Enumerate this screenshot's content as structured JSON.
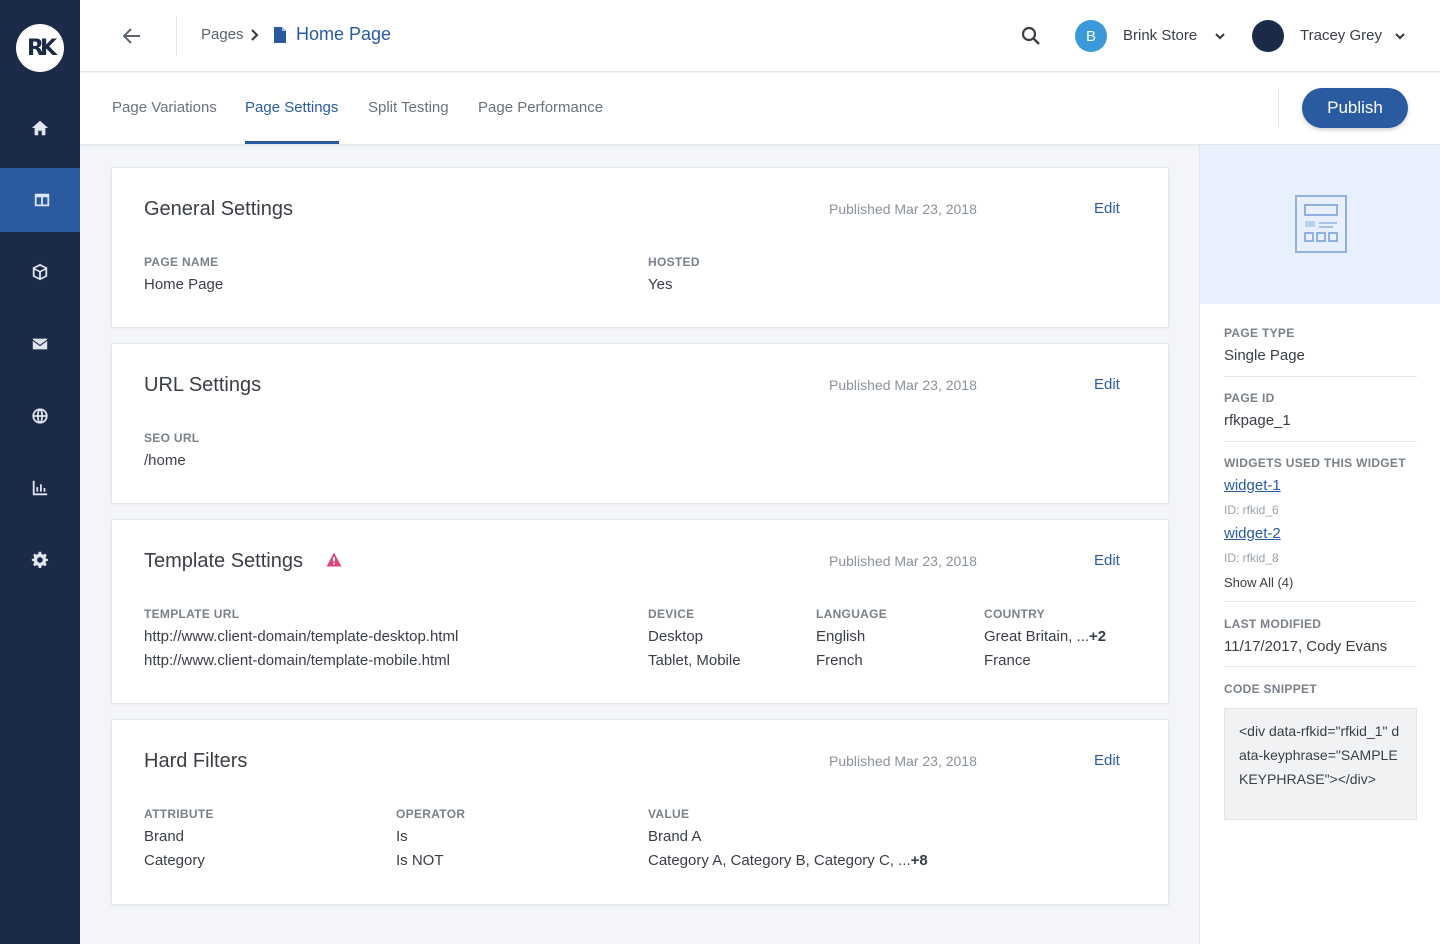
{
  "app": {
    "logo_text": "RK"
  },
  "sidebar": {
    "items": [
      {
        "icon": "home-icon",
        "name": "home"
      },
      {
        "icon": "layout-icon",
        "name": "pages",
        "active": true
      },
      {
        "icon": "cube-icon",
        "name": "products"
      },
      {
        "icon": "mail-icon",
        "name": "mail"
      },
      {
        "icon": "globe-icon",
        "name": "global"
      },
      {
        "icon": "bar-chart-icon",
        "name": "analytics"
      },
      {
        "icon": "gear-icon",
        "name": "settings"
      }
    ]
  },
  "header": {
    "breadcrumb_root": "Pages",
    "breadcrumb_current": "Home Page",
    "store_initial": "B",
    "store_name": "Brink Store",
    "user_name": "Tracey Grey"
  },
  "tabs": [
    {
      "label": "Page Variations"
    },
    {
      "label": "Page Settings",
      "active": true
    },
    {
      "label": "Split Testing"
    },
    {
      "label": "Page Performance"
    }
  ],
  "publish_label": "Publish",
  "cards": {
    "general": {
      "title": "General Settings",
      "published": "Published Mar 23, 2018",
      "edit": "Edit",
      "page_name_label": "PAGE NAME",
      "page_name": "Home Page",
      "hosted_label": "HOSTED",
      "hosted": "Yes"
    },
    "url": {
      "title": "URL Settings",
      "published": "Published Mar 23, 2018",
      "edit": "Edit",
      "seo_label": "SEO URL",
      "seo_value": "/home"
    },
    "template": {
      "title": "Template Settings",
      "published": "Published Mar 23, 2018",
      "edit": "Edit",
      "col_url": "TEMPLATE URL",
      "col_device": "DEVICE",
      "col_language": "LANGUAGE",
      "col_country": "COUNTRY",
      "rows": [
        {
          "url": "http://www.client-domain/template-desktop.html",
          "device": "Desktop",
          "language": "English",
          "country": "Great Britain, ...",
          "country_more": "+2"
        },
        {
          "url": "http://www.client-domain/template-mobile.html",
          "device": "Tablet, Mobile",
          "language": "French",
          "country": "France",
          "country_more": ""
        }
      ]
    },
    "filters": {
      "title": "Hard Filters",
      "published": "Published Mar 23, 2018",
      "edit": "Edit",
      "col_attribute": "ATTRIBUTE",
      "col_operator": "OPERATOR",
      "col_value": "VALUE",
      "rows": [
        {
          "attribute": "Brand",
          "operator": "Is",
          "value": "Brand A",
          "value_more": ""
        },
        {
          "attribute": "Category",
          "operator": "Is NOT",
          "value": "Category A, Category B, Category C, ...",
          "value_more": "+8"
        }
      ]
    }
  },
  "details": {
    "page_type_label": "PAGE TYPE",
    "page_type": "Single Page",
    "page_id_label": "PAGE ID",
    "page_id": "rfkpage_1",
    "widgets_label": "WIDGETS USED THIS WIDGET",
    "widgets": [
      {
        "name": "widget-1",
        "id": "ID: rfkid_6"
      },
      {
        "name": "widget-2",
        "id": "ID: rfkid_8"
      }
    ],
    "show_all": "Show All (4)",
    "last_modified_label": "LAST MODIFIED",
    "last_modified": "11/17/2017, Cody Evans",
    "code_label": "CODE SNIPPET",
    "code": "<div data-rfkid=\"rfkid_1\" data-keyphrase=\"SAMPLE KEYPHRASE\"></div>"
  },
  "colors": {
    "sidebar_bg": "#1b2a47",
    "accent": "#2a5aa0",
    "warning": "#e0457b",
    "store_avatar": "#3a9ad9"
  }
}
